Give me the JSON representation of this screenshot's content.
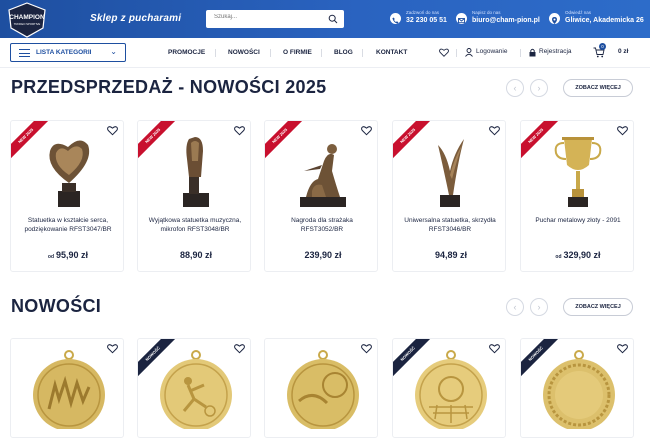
{
  "header": {
    "logo_text": "CHAMPION",
    "logo_subtext": "TROFEO SPORTIVE",
    "tagline": "Sklep z pucharami",
    "search": {
      "placeholder": "Szukaj..."
    },
    "phone": {
      "label": "Zadzwoń do nas",
      "value": "32 230 05 51"
    },
    "email": {
      "label": "Napisz do nas",
      "value": "biuro@cham-pion.pl"
    },
    "address": {
      "label": "Odwiedź nas",
      "value": "Gliwice, Akademicka 26"
    }
  },
  "nav": {
    "categories_label": "LISTA KATEGORII",
    "menu": [
      "PROMOCJE",
      "NOWOŚCI",
      "O FIRMIE",
      "BLOG",
      "KONTAKT"
    ],
    "login": "Logowanie",
    "register": "Rejestracja",
    "cart_count": "0",
    "cart_total": "0 zł"
  },
  "presale": {
    "title": "PRZEDSPRZEDAŻ - NOWOŚCI 2025",
    "more_label": "ZOBACZ WIĘCEJ",
    "products": [
      {
        "badge": "NEW 2025",
        "name": "Statuetka w kształcie serca, podziękowanie RFST3047/BR",
        "price_prefix": "od",
        "price": "95,90 zł"
      },
      {
        "badge": "NEW 2025",
        "name": "Wyjątkowa statuetka muzyczna, mikrofon RFST3048/BR",
        "price_prefix": "",
        "price": "88,90 zł"
      },
      {
        "badge": "NEW 2025",
        "name": "Nagroda dla strażaka RFST3052/BR",
        "price_prefix": "",
        "price": "239,90 zł"
      },
      {
        "badge": "NEW 2025",
        "name": "Uniwersalna statuetka, skrzydła RFST3046/BR",
        "price_prefix": "",
        "price": "94,89 zł"
      },
      {
        "badge": "NEW 2025",
        "name": "Puchar metalowy złoty - 2091",
        "price_prefix": "od",
        "price": "329,90 zł"
      }
    ]
  },
  "news": {
    "title": "NOWOŚCI",
    "more_label": "ZOBACZ WIĘCEJ",
    "products": [
      {
        "badge": ""
      },
      {
        "badge": "NOWOŚĆ"
      },
      {
        "badge": ""
      },
      {
        "badge": "NOWOŚĆ"
      },
      {
        "badge": "NOWOŚĆ"
      }
    ]
  },
  "colors": {
    "brand_blue": "#1e4fa0",
    "navy": "#1b2440",
    "badge_red": "#c8102e",
    "gold": "#c9a94a"
  }
}
